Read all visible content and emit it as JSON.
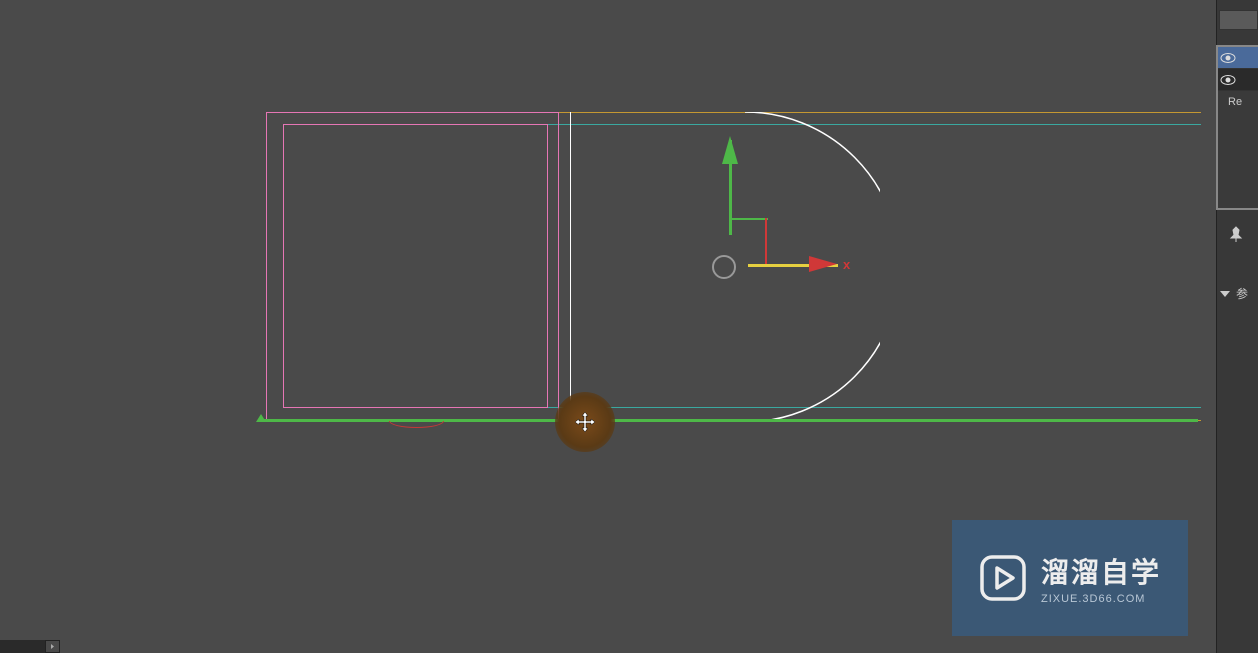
{
  "gizmo": {
    "x_label": "x"
  },
  "scene_layers": {
    "item_label": "Re"
  },
  "panel": {
    "section_header": "参"
  },
  "watermark": {
    "title": "溜溜自学",
    "url": "ZIXUE.3D66.COM"
  },
  "colors": {
    "viewport_bg": "#4a4a4a",
    "panel_bg": "#383838",
    "orange": "#c49832",
    "teal": "#3aa8a0",
    "pink": "#e676b5",
    "green": "#4eb848",
    "red": "#d03838",
    "yellow": "#e6d040",
    "watermark_bg": "#3a5a7a"
  }
}
